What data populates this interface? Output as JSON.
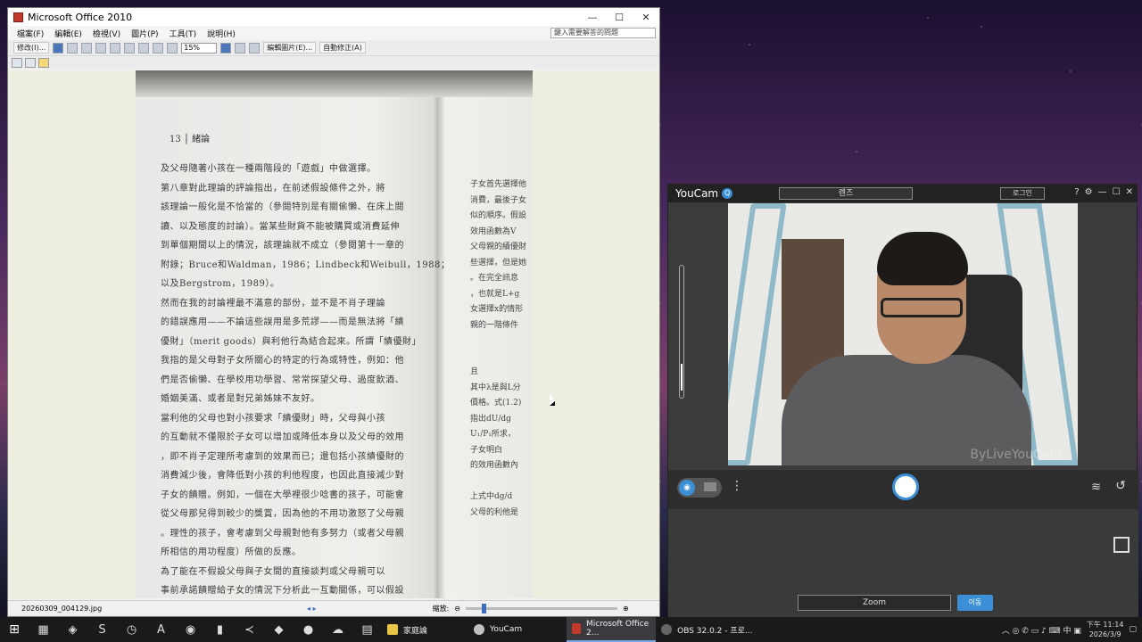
{
  "office": {
    "title": "Microsoft Office 2010",
    "win_min": "—",
    "win_max": "☐",
    "win_close": "✕",
    "menus": [
      "檔案(F)",
      "編輯(E)",
      "檢視(V)",
      "圖片(P)",
      "工具(T)",
      "說明(H)"
    ],
    "help_placeholder": "鍵入需要解答的問題",
    "toolbar": {
      "retouch_label": "修改(I)...",
      "zoom_value": "15%",
      "edit_picture_label": "編輯圖片(E)...",
      "auto_correct_label": "自動修正(A)"
    },
    "status": {
      "filename": "20260309_004129.jpg",
      "nav": "◂ ▸",
      "zoom_label": "縮放:"
    }
  },
  "document": {
    "page_number": "13 │ 緒論",
    "left_lines": [
      "及父母隨著小孩在一種兩階段的「遊戲」中做選擇。",
      "    第八章對此理論的評論指出，在前述假設條件之外，將",
      "該理論一般化是不恰當的（參閱特別是有關偷懶、在床上閱",
      "讀、以及態度的討論）。當某些財貨不能被購買或消費延伸",
      "到單個期間以上的情況，該理論就不成立（參閱第十一章的",
      "附錄；Bruce和Waldman，1986；Lindbeck和Weibull，1988；",
      "以及Bergstrom，1989）。",
      "    然而在我的討論裡最不滿意的部份，並不是不肖子理論",
      "的錯誤應用——不論這些誤用是多荒謬——而是無法將「績",
      "優財」（merit goods）與利他行為結合起來。所謂「績優財」",
      "我指的是父母對子女所關心的特定的行為或特性，例如：他",
      "們是否偷懶、在學校用功學習、常常探望父母、過度飲酒、",
      "婚姻美滿、或者是對兄弟姊妹不友好。",
      "    當利他的父母也對小孩要求「績優財」時，父母與小孩",
      "的互動就不僅限於子女可以增加或降低本身以及父母的效用",
      "，即不肖子定理所考慮到的效果而已；還包括小孩績優財的",
      "消費減少後，會降低對小孩的利他程度，也因此直接減少對",
      "子女的饋贈。例如，一個在大學裡很少唸書的孩子，可能會",
      "從父母那兒得到較少的獎賞，因為他的不用功激怒了父母親",
      "。理性的孩子，會考慮到父母親對他有多努力（或者父母親",
      "所相信的用功程度）所做的反應。",
      "    為了能在不假設父母與子女間的直接談判或父母親可以",
      "事前承諾饋贈給子女的情況下分析此一互動關係，可以假設"
    ],
    "right_lines": [
      "子女首先選擇他",
      "消費，最後子女",
      "似的順序。假設",
      "效用函數為V",
      "父母親的績優財",
      "些選擇，但是她",
      "。在完全訊息",
      "，也就是L+g",
      "女選擇x的情形",
      "親的一階條件",
      "",
      "",
      "且",
      "其中λ是與L分",
      "價格。式(1.2)",
      "指出dU/dg",
      "U₁/P₁所求，",
      "    子女明白",
      "的效用函數內",
      "",
      "上式中dg/d",
      "父母的利他是"
    ]
  },
  "youcam": {
    "title": "YouCam",
    "badge": "Q",
    "dropdown_value": "렌즈",
    "login_label": "로그인",
    "help_icon": "?",
    "settings_icon": "⚙",
    "min_icon": "—",
    "max_icon": "☐",
    "close_icon": "✕",
    "more_icon": "⋮",
    "layers_icon": "≋",
    "rotate_icon": "↺",
    "camera_icon": "◉",
    "watermark": "ByLiveYouCam",
    "zoom_label": "Zoom",
    "go_label": "이동"
  },
  "taskbar": {
    "start_icon": "⊞",
    "pinned": [
      "calculator-icon",
      "store-icon",
      "s-icon",
      "clock-icon",
      "a-icon",
      "steam-icon",
      "usb-icon",
      "vscode-icon",
      "vs-icon",
      "firefox-icon",
      "cloud-icon",
      "notes-icon"
    ],
    "pinned_glyphs": [
      "▦",
      "◈",
      "S",
      "◷",
      "A",
      "◉",
      "▮",
      "≺",
      "◆",
      "●",
      "☁",
      "▤"
    ],
    "tasks": [
      {
        "label": "家庭論",
        "color": "#e8c547"
      },
      {
        "label": "YouCam",
        "color": "#c0c0c0"
      },
      {
        "label": "Microsoft Office 2...",
        "color": "#c0392b"
      },
      {
        "label": "OBS 32.0.2 - 프로...",
        "color": "#666666"
      }
    ],
    "tray_glyphs": "︿ ◎ ✆ ▭ ♪ ⌨ 中 ▣",
    "time": "下午 11:14",
    "date": "2026/3/9",
    "notification_icon": "▢"
  }
}
